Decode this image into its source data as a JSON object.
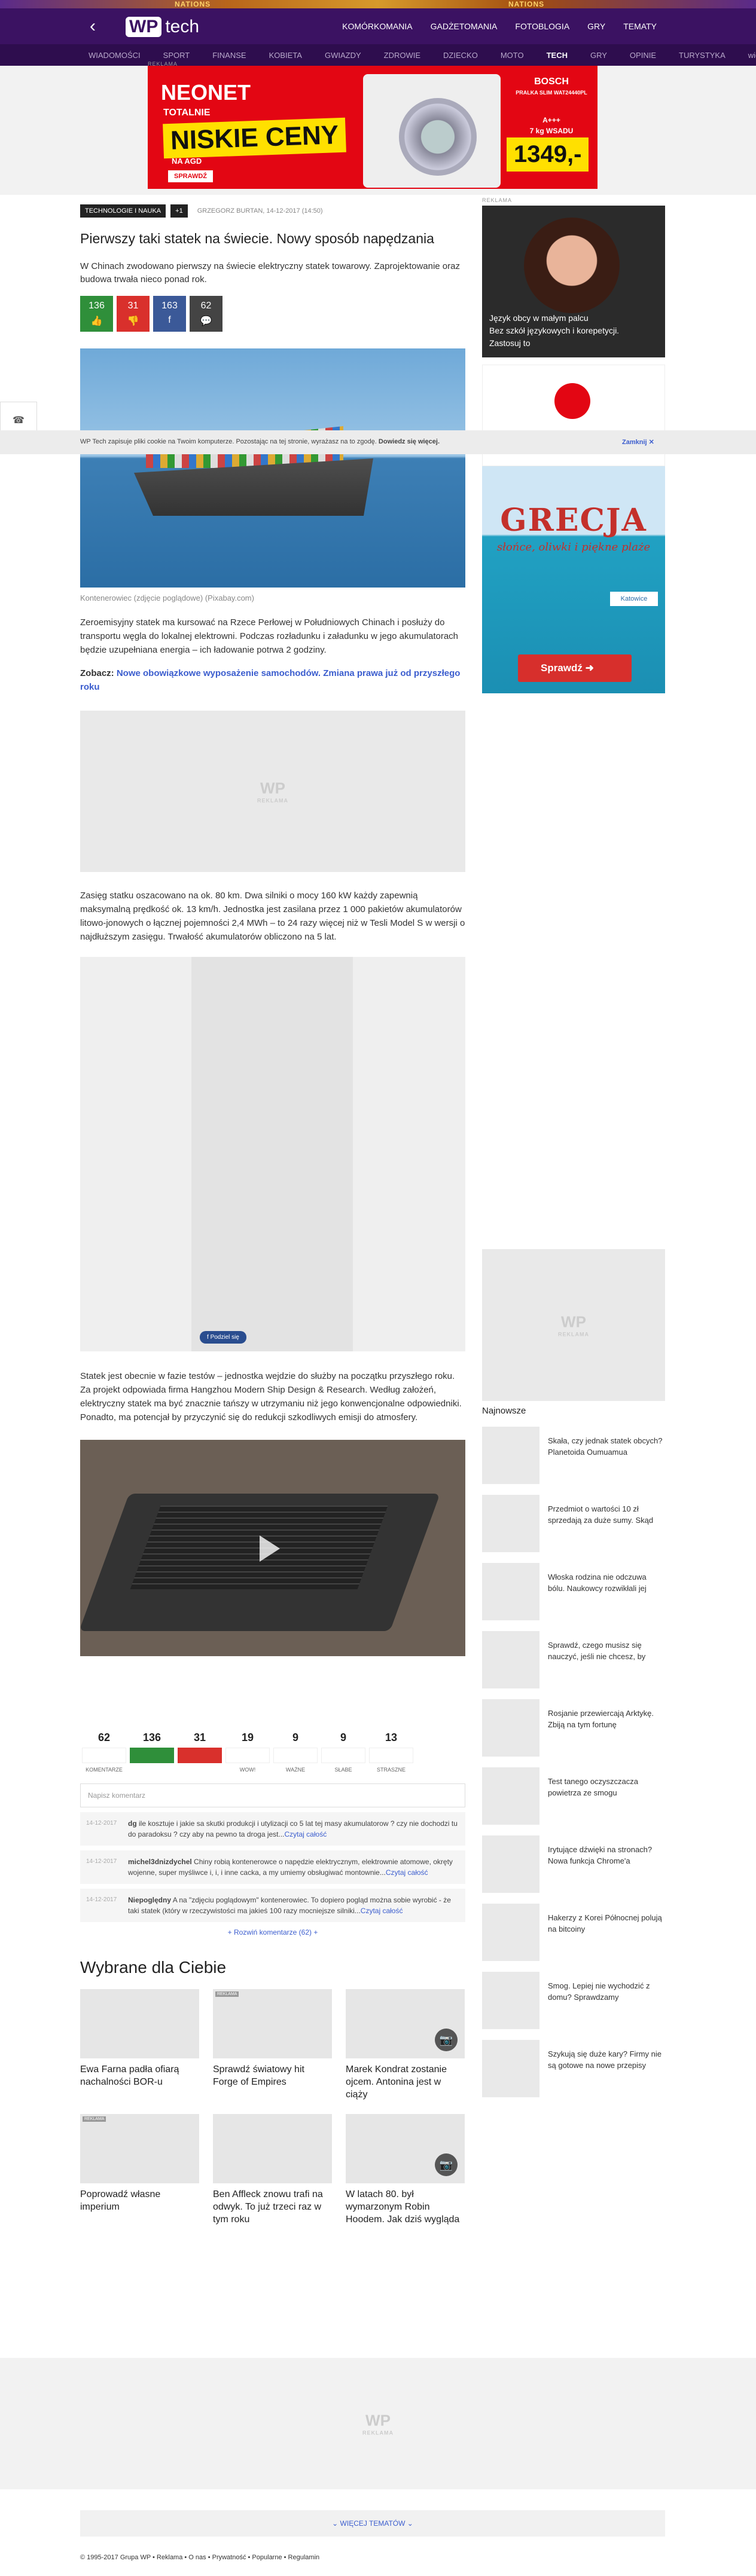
{
  "header": {
    "strip_text": "NATIONS",
    "brand_word": "tech",
    "logo_mark": "WP",
    "topnav": [
      "KOMÓRKOMANIA",
      "GADŻETOMANIA",
      "FOTOBLOGIA",
      "GRY",
      "TEMATY"
    ],
    "subnav": [
      "WIADOMOŚCI",
      "SPORT",
      "FINANSE",
      "KOBIETA",
      "GWIAZDY",
      "ZDROWIE",
      "DZIECKO",
      "MOTO",
      "TECH",
      "GRY",
      "OPINIE",
      "TURYSTYKA",
      "więcej"
    ]
  },
  "ad_label": "REKLAMA",
  "top_ad": {
    "brand": "NEONET",
    "line1": "TOTALNIE",
    "line2": "NISKIE CENY",
    "line3": "NA AGD",
    "cta": "SPRAWDŹ",
    "product": "BOSCH",
    "product_details": "PRALKA SLIM WAT24440PL",
    "energy": "A+++",
    "load": "7 kg WSADU",
    "price": "1349,-"
  },
  "article": {
    "tag": "TECHNOLOGIE I NAUKA",
    "tag_count": "+1",
    "author": "GRZEGORZ BURTAN, 14-12-2017 (14:50)",
    "title": "Pierwszy taki statek na świecie. Nowy sposób napędzania",
    "lead": "W Chinach zwodowano pierwszy na świecie elektryczny statek towarowy. Zaprojektowanie oraz budowa trwała nieco ponad rok.",
    "social": [
      {
        "count": "136",
        "icon": "👍",
        "color": "#2f8f3a"
      },
      {
        "count": "31",
        "icon": "👎",
        "color": "#d9302c"
      },
      {
        "count": "163",
        "icon": "f",
        "color": "#3b5998"
      },
      {
        "count": "62",
        "icon": "💬",
        "color": "#444"
      }
    ],
    "caption": "Kontenerowiec (zdjęcie poglądowe) (Pixabay.com)",
    "p1": "Zeroemisyjny statek ma kursować na Rzece Perłowej w Południowych Chinach i posłuży do transportu węgla do lokalnej elektrowni. Podczas rozładunku i załadunku w jego akumulatorach będzie uzupełniana energia – ich ładowanie potrwa 2 godziny.",
    "zobacz_label": "Zobacz:",
    "zobacz_link": "Nowe obowiązkowe wyposażenie samochodów. Zmiana prawa już od przyszłego roku",
    "p2": "Zasięg statku oszacowano na ok. 80 km. Dwa silniki o mocy 160 kW każdy zapewnią maksymalną prędkość ok. 13 km/h. Jednostka jest zasilana przez 1 000 pakietów akumulatorów litowo-jonowych o łącznej pojemności 2,4 MWh – to 24 razy więcej niż w Tesli Model S w wersji o najdłuższym zasięgu. Trwałość akumulatorów obliczono na 5 lat.",
    "p3": "Statek jest obecnie w fazie testów – jednostka wejdzie do służby na początku przyszłego roku. Za projekt odpowiada firma Hangzhou Modern Ship Design & Research. Według założeń, elektryczny statek ma być znacznie tańszy w utrzymaniu niż jego konwencjonalne odpowiedniki. Ponadto, ma potencjał by przyczynić się do redukcji szkodliwych emisji do atmosfery.",
    "fb_share": "Podziel się"
  },
  "placeholder_logo": "WP",
  "reactions": [
    {
      "num": "62",
      "lbl": "KOMENTARZE",
      "color": "#fff"
    },
    {
      "num": "136",
      "lbl": "",
      "color": "#2f8f3a"
    },
    {
      "num": "31",
      "lbl": "",
      "color": "#d9302c"
    },
    {
      "num": "19",
      "lbl": "WOW!",
      "color": "#fff"
    },
    {
      "num": "9",
      "lbl": "WAŻNE",
      "color": "#fff"
    },
    {
      "num": "9",
      "lbl": "SŁABE",
      "color": "#fff"
    },
    {
      "num": "13",
      "lbl": "STRASZNE",
      "color": "#fff"
    }
  ],
  "comment_placeholder": "Napisz komentarz",
  "comments": [
    {
      "date": "14-12-2017",
      "user": "dg",
      "text": " ile kosztuje i jakie sa skutki produkcji i utylizacji co 5 lat tej masy akumulatorow ? czy nie dochodzi tu do paradoksu ? czy aby na pewno ta droga jest...",
      "more": "Czytaj całość"
    },
    {
      "date": "14-12-2017",
      "user": "michel3dnizdychel",
      "text": " Chiny robią kontenerowce o napędzie elektrycznym, elektrownie atomowe, okręty wojenne, super myśliwce i, i, i inne cacka, a my umiemy obsługiwać montownie...",
      "more": "Czytaj całość"
    },
    {
      "date": "14-12-2017",
      "user": "Niepoględny",
      "text": " A na \"zdjęciu poglądowym\" kontenerowiec. To dopiero pogląd można sobie wyrobić - że taki statek (który w rzeczywistości ma jakieś 100 razy mocniejsze silniki...",
      "more": "Czytaj całość"
    }
  ],
  "expand_comments": "+ Rozwiń komentarze (62) +",
  "recommended_title": "Wybrane dla Ciebie",
  "recommended": [
    {
      "text": "Ewa Farna padła ofiarą nachalności BOR-u",
      "rekl": false,
      "cam": false
    },
    {
      "text": "Sprawdź światowy hit Forge of Empires",
      "rekl": true,
      "cam": false
    },
    {
      "text": "Marek Kondrat zostanie ojcem. Antonina jest w ciąży",
      "rekl": false,
      "cam": true
    },
    {
      "text": "Poprowadź własne imperium",
      "rekl": true,
      "cam": false
    },
    {
      "text": "Ben Affleck znowu trafi na odwyk. To już trzeci raz w tym roku",
      "rekl": false,
      "cam": false
    },
    {
      "text": "W latach 80. był wymarzonym Robin Hoodem. Jak dziś wygląda",
      "rekl": false,
      "cam": true
    }
  ],
  "sidebar": {
    "ad1_text": "Język obcy w małym palcu\nBez szkół językowych i korepetycji.\nZastosuj to",
    "ad3_title": "GRECJA",
    "ad3_sub": "słońce, oliwki i piękne plaże",
    "ad3_city": "Katowice",
    "ad3_cta": "Sprawdź",
    "newest_title": "Najnowsze",
    "newest": [
      "Skała, czy jednak statek obcych? Planetoida Oumuamua",
      "Przedmiot o wartości 10 zł sprzedają za duże sumy. Skąd",
      "Włoska rodzina nie odczuwa bólu. Naukowcy rozwikłali jej",
      "Sprawdź, czego musisz się nauczyć, jeśli nie chcesz, by",
      "Rosjanie przewiercają Arktykę. Zbiją na tym fortunę",
      "Test tanego oczyszczacza powietrza ze smogu",
      "Irytujące dźwięki na stronach? Nowa funkcja Chrome'a",
      "Hakerzy z Korei Północnej polują na bitcoiny",
      "Smog. Lepiej nie wychodzić z domu? Sprawdzamy",
      "Szykują się duże kary? Firmy nie są gotowe na nowe przepisy"
    ]
  },
  "cookie": {
    "text": "WP Tech zapisuje pliki cookie na Twoim komputerze. Pozostając na tej stronie, wyrażasz na to zgodę. ",
    "link": "Dowiedz się więcej.",
    "close": "Zamknij ✕"
  },
  "more_topics": "⌄ WIĘCEJ TEMATÓW ⌄",
  "copyright": "© 1995-2017 Grupa WP  •  Reklama  •  O nas  •  Prywatność  •  Popularne  •  Regulamin"
}
